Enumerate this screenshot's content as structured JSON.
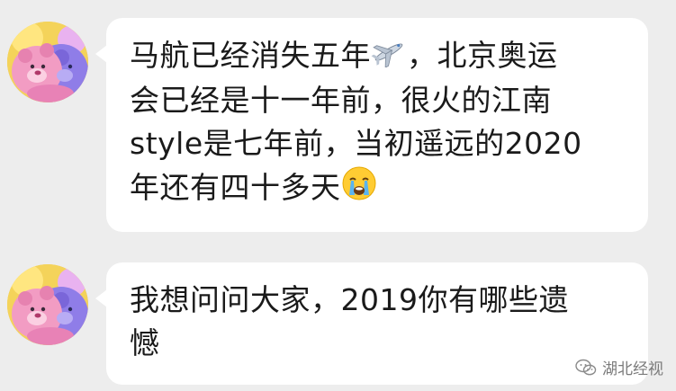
{
  "messages": [
    {
      "line1": "马航已经消失五年",
      "emoji1": "airplane-emoji",
      "line1b": "，北京奥运",
      "line2": "会已经是十一年前，很火的江南",
      "line3": "style是七年前，当初遥远的2020",
      "line4": "年还有四十多天",
      "emoji2": "crying-face-emoji"
    },
    {
      "line1": "我想问问大家，2019你有哪些遗",
      "line2": "憾"
    }
  ],
  "watermark": {
    "text": "湖北经视",
    "icon": "wechat-icon"
  },
  "colors": {
    "background": "#ededed",
    "bubble": "#ffffff",
    "text": "#1a1a1a"
  }
}
